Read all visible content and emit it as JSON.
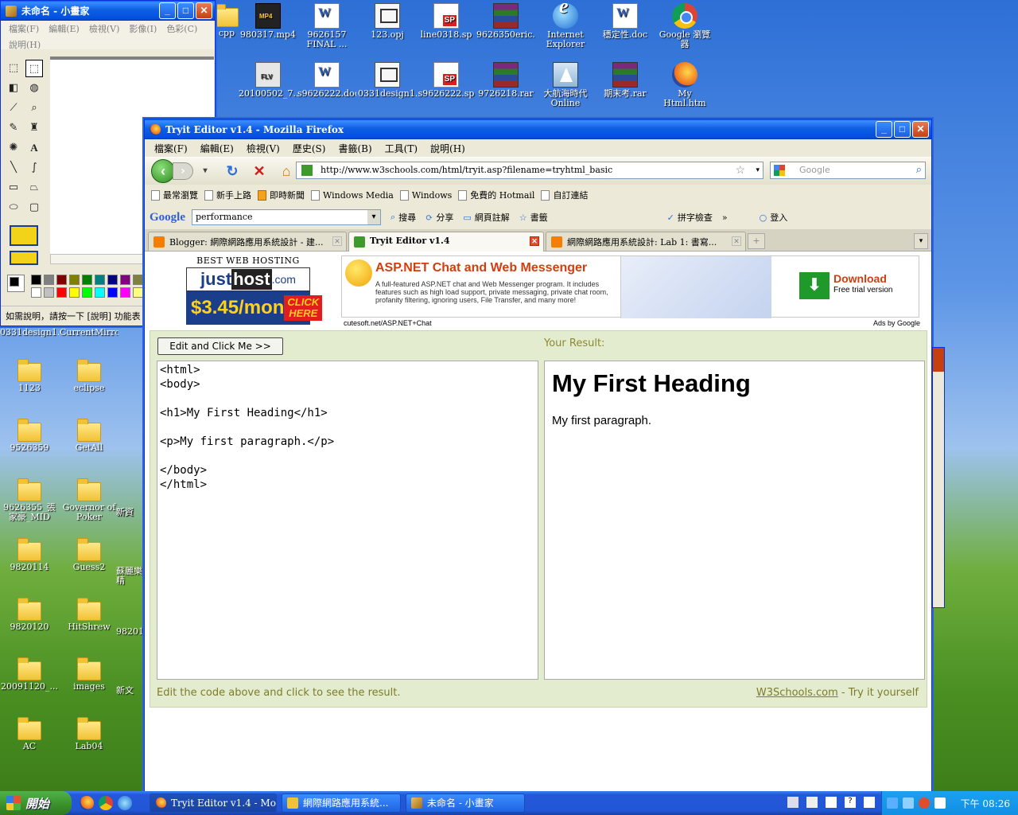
{
  "desktop": {
    "icons_top": [
      {
        "label": "cpp",
        "type": "folder"
      },
      {
        "label": "980317.mp4",
        "type": "mp4"
      },
      {
        "label": "9626157 FINAL ...",
        "type": "doc"
      },
      {
        "label": "123.opj",
        "type": "opj"
      },
      {
        "label": "line0318.sp",
        "type": "sp"
      },
      {
        "label": "9626350eric....",
        "type": "rar"
      },
      {
        "label": "Internet Explorer",
        "type": "ie"
      },
      {
        "label": "穩定性.doc",
        "type": "doc"
      },
      {
        "label": "Google 瀏覽器",
        "type": "chrome"
      }
    ],
    "icons_row2": [
      {
        "label": "20100502_7...",
        "type": "flv"
      },
      {
        "label": "s9626222.doc",
        "type": "doc"
      },
      {
        "label": "0331design1...",
        "type": "opj"
      },
      {
        "label": "s9626222.sp",
        "type": "sp"
      },
      {
        "label": "9726218.rar",
        "type": "rar"
      },
      {
        "label": "大航海時代 Online",
        "type": "ship"
      },
      {
        "label": "期末考.rar",
        "type": "rar"
      },
      {
        "label": "My Html.htm",
        "type": "ff"
      }
    ],
    "left_strip": [
      "0331design1...",
      "CurrentMirror"
    ],
    "icons_left": [
      {
        "label": "1123"
      },
      {
        "label": "eclipse"
      },
      {
        "label": "9526359"
      },
      {
        "label": "GetAll"
      },
      {
        "label": "9626355_張家豪_MID"
      },
      {
        "label": "Governor of Poker"
      },
      {
        "label": "9820114"
      },
      {
        "label": "Guess2"
      },
      {
        "label": "9820120"
      },
      {
        "label": "HitShrew"
      },
      {
        "label": "20091120_..."
      },
      {
        "label": "images"
      },
      {
        "label": "AC"
      },
      {
        "label": "Lab04"
      }
    ],
    "partial_labels": [
      "新資",
      "新資",
      "蘇麗樂精",
      "98201",
      "新文"
    ]
  },
  "paint": {
    "title": "未命名 - 小畫家",
    "menu": [
      "檔案(F)",
      "編輯(E)",
      "檢視(V)",
      "影像(I)",
      "色彩(C)",
      "說明(H)"
    ],
    "status": "如需說明，請按一下 [說明] 功能表",
    "colors": [
      "#000000",
      "#808080",
      "#800000",
      "#808000",
      "#008000",
      "#008080",
      "#000080",
      "#800080",
      "#808040",
      "#004040",
      "#0080ff",
      "#004080",
      "#8000ff",
      "#804000",
      "#ffffff",
      "#c0c0c0",
      "#ff0000",
      "#ffff00",
      "#00ff00",
      "#00ffff",
      "#0000ff",
      "#ff00ff",
      "#ffff80",
      "#00ff80",
      "#80ffff",
      "#8080ff",
      "#ff0080",
      "#ff8040"
    ]
  },
  "firefox": {
    "title": "Tryit Editor v1.4 - Mozilla Firefox",
    "menu": [
      "檔案(F)",
      "編輯(E)",
      "檢視(V)",
      "歷史(S)",
      "書籤(B)",
      "工具(T)",
      "說明(H)"
    ],
    "url": "http://www.w3schools.com/html/tryit.asp?filename=tryhtml_basic",
    "search_placeholder": "Google",
    "bookmarks": [
      "最常瀏覽",
      "新手上路",
      "即時新聞",
      "Windows Media",
      "Windows",
      "免費的 Hotmail",
      "自訂連結"
    ],
    "google_toolbar": {
      "logo": "Google",
      "query": "performance",
      "items": [
        "搜尋",
        "分享",
        "網頁註解",
        "書籤",
        "拼字檢查",
        "»",
        "登入"
      ]
    },
    "tabs": [
      {
        "label": "Blogger: 網際網路應用系統設計 - 建...",
        "active": false
      },
      {
        "label": "Tryit Editor v1.4",
        "active": true
      },
      {
        "label": "網際網路應用系統設計: Lab 1: 書寫...",
        "active": false
      }
    ],
    "ads": {
      "host_best": "BEST WEB HOSTING",
      "host_logo_a": "just",
      "host_logo_b": "host",
      "host_logo_c": ".com",
      "host_price": "$3.45/mon",
      "host_click": "CLICK HERE",
      "asp_title": "ASP.NET Chat and Web Messenger",
      "asp_desc": "A full-featured ASP.NET chat and Web Messenger program. It includes features such as high load support, private messaging, private chat room, profanity filtering, ignoring users, File Transfer, and many more!",
      "download": "Download",
      "trial": "Free trial version",
      "ad_url": "cutesoft.net/ASP.NET+Chat",
      "ads_by": "Ads by Google"
    },
    "tryit": {
      "button": "Edit and Click Me >>",
      "your_result": "Your Result:",
      "code": "<html>\n<body>\n\n<h1>My First Heading</h1>\n\n<p>My first paragraph.</p>\n\n</body>\n</html>",
      "result_heading": "My First Heading",
      "result_paragraph": "My first paragraph.",
      "footer_left": "Edit the code above and click to see the result.",
      "footer_link": "W3Schools.com",
      "footer_right": " - Try it yourself"
    }
  },
  "taskbar": {
    "start": "開始",
    "tasks": [
      {
        "label": "Tryit Editor v1.4 - Mo...",
        "active": true
      },
      {
        "label": "網際網路應用系統...",
        "active": false
      },
      {
        "label": "未命名 - 小畫家",
        "active": false
      }
    ],
    "clock": "下午 08:26"
  }
}
